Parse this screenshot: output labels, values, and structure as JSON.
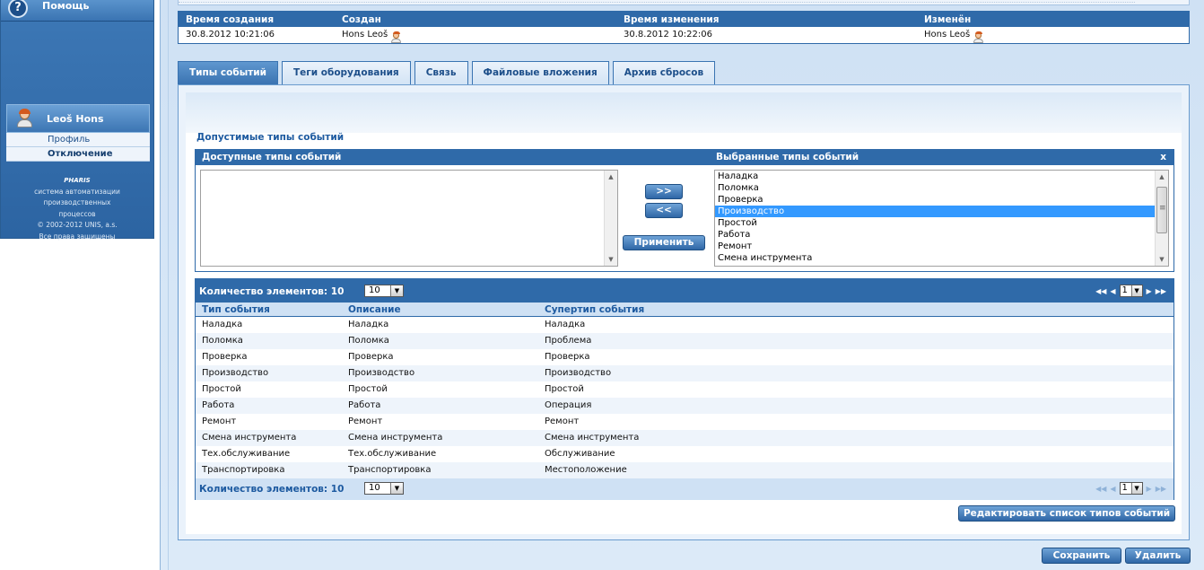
{
  "sidebar": {
    "help_label": "Помощь",
    "user": {
      "name": "Leoš Hons",
      "profile_link": "Профиль",
      "logout_link": "Отключение"
    },
    "footer": {
      "logo": "PHARIS",
      "line1": "система автоматизации производственных",
      "line2": "процессов",
      "line3": "© 2002-2012 UNIS, a.s.",
      "line4": "Все права защищены"
    }
  },
  "meta": {
    "headers": {
      "created_time": "Время создания",
      "created_by": "Создан",
      "modified_time": "Время изменения",
      "modified_by": "Изменён"
    },
    "values": {
      "created_time": "30.8.2012 10:21:06",
      "created_by": "Hons Leoš",
      "modified_time": "30.8.2012 10:22:06",
      "modified_by": "Hons Leoš"
    }
  },
  "tabs": [
    {
      "label": "Типы событий",
      "active": true
    },
    {
      "label": "Теги оборудования",
      "active": false
    },
    {
      "label": "Связь",
      "active": false
    },
    {
      "label": "Файловые вложения",
      "active": false
    },
    {
      "label": "Архив сбросов",
      "active": false
    }
  ],
  "section_title": "Допустимые типы событий",
  "selector": {
    "available_header": "Доступные типы событий",
    "selected_header": "Выбранные типы событий",
    "close_label": "x",
    "available_items": [],
    "selected_items": [
      {
        "label": "Наладка",
        "selected": false
      },
      {
        "label": "Поломка",
        "selected": false
      },
      {
        "label": "Проверка",
        "selected": false
      },
      {
        "label": "Производство",
        "selected": true
      },
      {
        "label": "Простой",
        "selected": false
      },
      {
        "label": "Работа",
        "selected": false
      },
      {
        "label": "Ремонт",
        "selected": false
      },
      {
        "label": "Смена инструмента",
        "selected": false
      }
    ],
    "add_button": ">>",
    "remove_button": "<<",
    "apply_button": "Применить"
  },
  "grid": {
    "count_label": "Количество элементов: 10",
    "page_size": "10",
    "page_number": "1",
    "columns": [
      "Тип события",
      "Описание",
      "Супертип события"
    ],
    "rows": [
      [
        "Наладка",
        "Наладка",
        "Наладка"
      ],
      [
        "Поломка",
        "Поломка",
        "Проблема"
      ],
      [
        "Проверка",
        "Проверка",
        "Проверка"
      ],
      [
        "Производство",
        "Производство",
        "Производство"
      ],
      [
        "Простой",
        "Простой",
        "Простой"
      ],
      [
        "Работа",
        "Работа",
        "Операция"
      ],
      [
        "Ремонт",
        "Ремонт",
        "Ремонт"
      ],
      [
        "Смена инструмента",
        "Смена инструмента",
        "Смена инструмента"
      ],
      [
        "Тех.обслуживание",
        "Тех.обслуживание",
        "Обслуживание"
      ],
      [
        "Транспортировка",
        "Транспортировка",
        "Местоположение"
      ]
    ]
  },
  "actions": {
    "edit_list": "Редактировать список типов событий",
    "save": "Сохранить",
    "delete": "Удалить"
  }
}
